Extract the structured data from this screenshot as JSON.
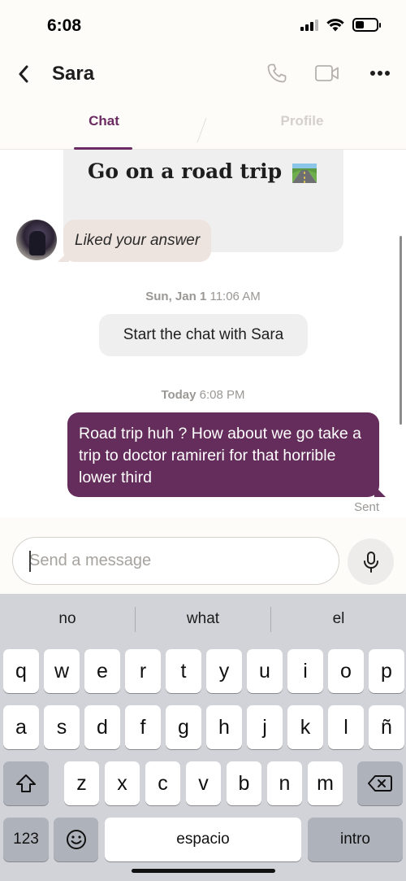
{
  "status_bar": {
    "time": "6:08"
  },
  "header": {
    "contact_name": "Sara",
    "icons": [
      "chevron-left-icon",
      "phone-icon",
      "video-icon",
      "more-icon"
    ]
  },
  "tabs": [
    {
      "label": "Chat",
      "active": true
    },
    {
      "label": "Profile",
      "active": false
    }
  ],
  "chat": {
    "prompt_card": {
      "title": "Go on a road trip"
    },
    "liked": {
      "text": "Liked your answer"
    },
    "timestamp1": {
      "day": "Sun, Jan 1",
      "time": "11:06 AM"
    },
    "system_message": "Start the chat with Sara",
    "timestamp2": {
      "day": "Today",
      "time": "6:08 PM"
    },
    "sent_message": "Road trip huh ? How about we go take a trip to doctor ramireri for that horrible lower third",
    "sent_status": "Sent"
  },
  "composer": {
    "placeholder": "Send a message"
  },
  "keyboard": {
    "suggestions": [
      "no",
      "what",
      "el"
    ],
    "row1": [
      "q",
      "w",
      "e",
      "r",
      "t",
      "y",
      "u",
      "i",
      "o",
      "p"
    ],
    "row2": [
      "a",
      "s",
      "d",
      "f",
      "g",
      "h",
      "j",
      "k",
      "l",
      "ñ"
    ],
    "row3": [
      "z",
      "x",
      "c",
      "v",
      "b",
      "n",
      "m"
    ],
    "numbers_key": "123",
    "space_key": "espacio",
    "return_key": "intro"
  },
  "colors": {
    "accent": "#652d5b",
    "tab_active": "#6b2a61",
    "liked_bg": "#ede4df",
    "bubble_gray": "#f0efef"
  }
}
